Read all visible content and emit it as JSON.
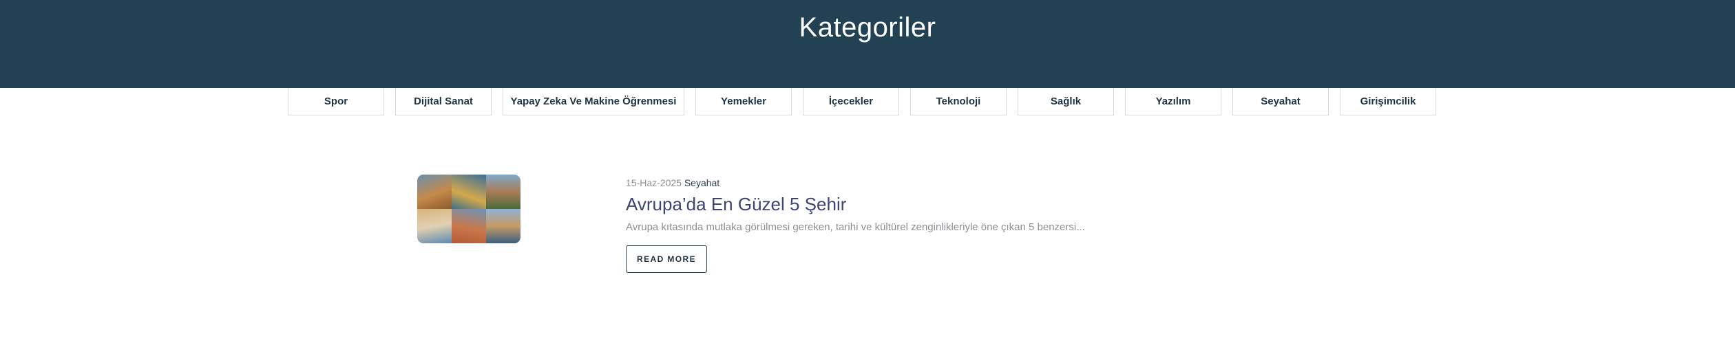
{
  "header": {
    "title": "Kategoriler",
    "background": "#224254"
  },
  "categories": [
    {
      "label": "Spor"
    },
    {
      "label": "Dijital Sanat"
    },
    {
      "label": "Yapay Zeka Ve Makine Öğrenmesi"
    },
    {
      "label": "Yemekler"
    },
    {
      "label": "İçecekler"
    },
    {
      "label": "Teknoloji"
    },
    {
      "label": "Sağlık"
    },
    {
      "label": "Yazılım"
    },
    {
      "label": "Seyahat"
    },
    {
      "label": "Girişimcilik"
    }
  ],
  "posts": [
    {
      "date": "15-Haz-2025",
      "category": "Seyahat",
      "title": "Avrupa’da En Güzel 5 Şehir",
      "excerpt": "Avrupa kıtasında mutlaka görülmesi gereken, tarihi ve kültürel zenginlikleriyle öne çıkan 5 benzersi...",
      "read_more_label": "READ MORE",
      "thumbnail": "europe-cities-collage"
    }
  ]
}
